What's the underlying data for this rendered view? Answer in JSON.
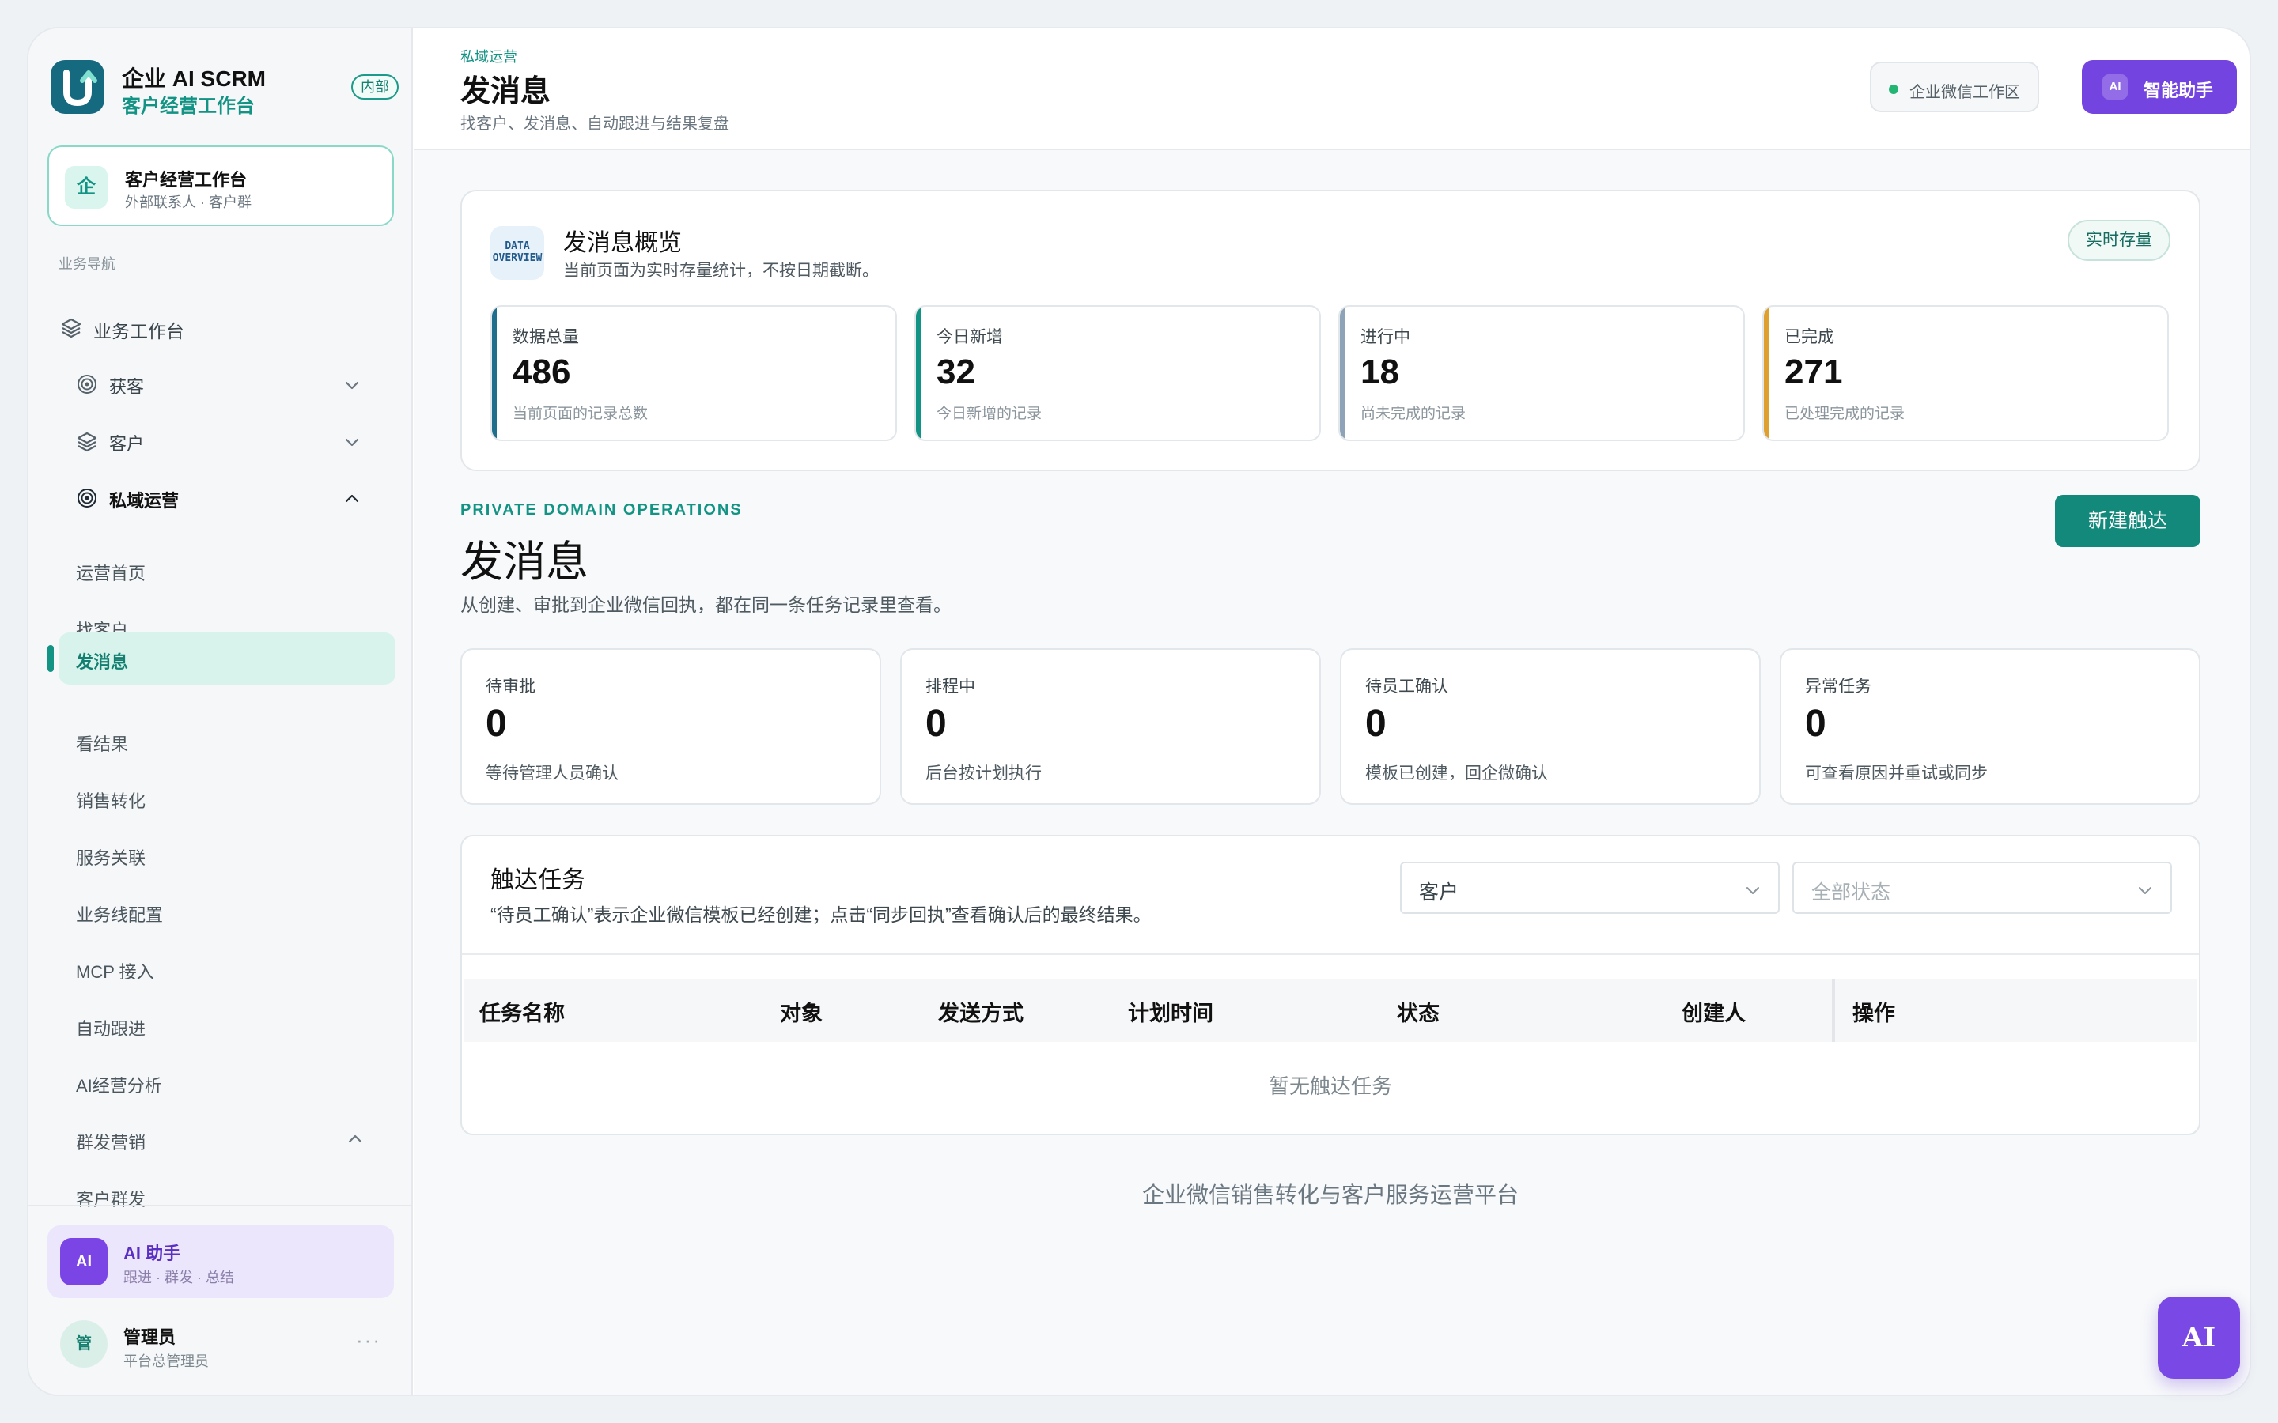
{
  "brand": {
    "title": "企业 AI SCRM",
    "subtitle": "客户经营工作台",
    "badge": "内部",
    "logo_icon": "u-logo-icon"
  },
  "workspace_card": {
    "icon_text": "企",
    "title": "客户经营工作台",
    "subtitle": "外部联系人 · 客户群"
  },
  "sidebar": {
    "section_label": "业务导航",
    "top_item": {
      "label": "业务工作台",
      "icon": "layers-icon"
    },
    "groups": [
      {
        "label": "获客",
        "icon": "target-icon",
        "expanded": false
      },
      {
        "label": "客户",
        "icon": "layers-icon",
        "expanded": false
      },
      {
        "label": "私域运营",
        "icon": "target-icon",
        "expanded": true
      }
    ],
    "sub_items": [
      "运营首页",
      "找客户",
      "发消息",
      "看结果",
      "销售转化",
      "服务关联",
      "业务线配置",
      "MCP 接入",
      "自动跟进",
      "AI经营分析"
    ],
    "active_item": "发消息",
    "group2": {
      "label": "群发营销",
      "expanded": true
    },
    "group2_items": [
      "客户群发"
    ]
  },
  "ai_assistant_card": {
    "avatar": "AI",
    "title": "AI 助手",
    "subtitle": "跟进 · 群发 · 总结"
  },
  "user": {
    "avatar": "管",
    "name": "管理员",
    "role": "平台总管理员",
    "more": "···"
  },
  "header": {
    "breadcrumb": "私域运营",
    "title": "发消息",
    "description": "找客户、发消息、自动跟进与结果复盘",
    "workspace_pill": "企业微信工作区",
    "ai_button_tag": "AI",
    "ai_button_label": "智能助手"
  },
  "overview": {
    "icon_text_1": "DATA",
    "icon_text_2": "OVERVIEW",
    "title": "发消息概览",
    "description": "当前页面为实时存量统计，不按日期截断。",
    "badge": "实时存量",
    "stats": [
      {
        "label": "数据总量",
        "value": "486",
        "hint": "当前页面的记录总数",
        "color": "#1f6e8c"
      },
      {
        "label": "今日新增",
        "value": "32",
        "hint": "今日新增的记录",
        "color": "#139384"
      },
      {
        "label": "进行中",
        "value": "18",
        "hint": "尚未完成的记录",
        "color": "#8fa3b8"
      },
      {
        "label": "已完成",
        "value": "271",
        "hint": "已处理完成的记录",
        "color": "#e0a030"
      }
    ]
  },
  "section": {
    "kicker": "PRIVATE DOMAIN OPERATIONS",
    "title": "发消息",
    "description": "从创建、审批到企业微信回执，都在同一条任务记录里查看。",
    "new_button": "新建触达"
  },
  "kpis": [
    {
      "label": "待审批",
      "value": "0",
      "hint": "等待管理人员确认"
    },
    {
      "label": "排程中",
      "value": "0",
      "hint": "后台按计划执行"
    },
    {
      "label": "待员工确认",
      "value": "0",
      "hint": "模板已创建，回企微确认"
    },
    {
      "label": "异常任务",
      "value": "0",
      "hint": "可查看原因并重试或同步"
    }
  ],
  "tasks": {
    "title": "触达任务",
    "description": "“待员工确认”表示企业微信模板已经创建；点击“同步回执”查看确认后的最终结果。",
    "filter_target": "客户",
    "filter_status_placeholder": "全部状态",
    "columns": [
      "任务名称",
      "对象",
      "发送方式",
      "计划时间",
      "状态",
      "创建人",
      "操作"
    ],
    "empty_text": "暂无触达任务"
  },
  "footer": "企业微信销售转化与客户服务运营平台",
  "fab_label": "AI",
  "colors": {
    "brand_teal": "#139384",
    "ai_purple": "#7444e0"
  }
}
